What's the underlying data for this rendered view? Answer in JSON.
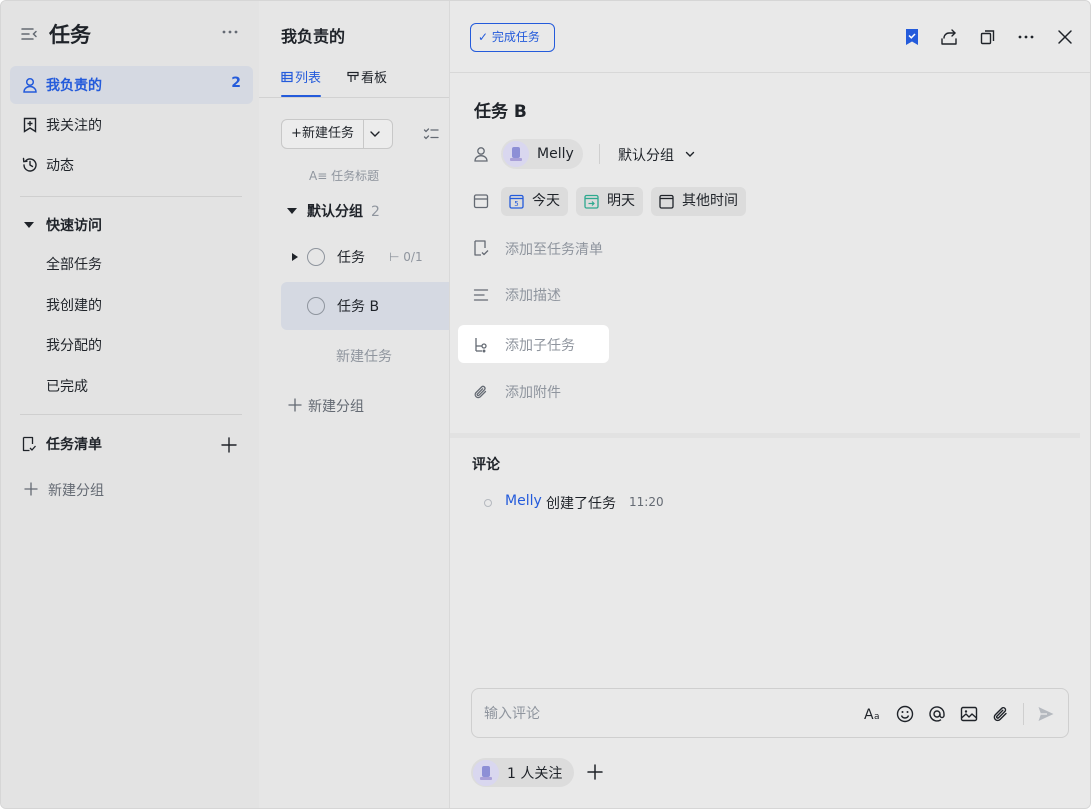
{
  "sidebar": {
    "title": "任务",
    "nav": [
      {
        "label": "我负责的",
        "count": "2"
      },
      {
        "label": "我关注的"
      },
      {
        "label": "动态"
      }
    ],
    "quick_access": {
      "label": "快速访问",
      "items": [
        "全部任务",
        "我创建的",
        "我分配的",
        "已完成"
      ]
    },
    "task_lists": {
      "label": "任务清单"
    },
    "new_group_label": "新建分组"
  },
  "list_panel": {
    "title": "我负责的",
    "tabs": [
      {
        "label": "列表",
        "active": true
      },
      {
        "label": "看板",
        "active": false
      }
    ],
    "new_task_button": "新建任务",
    "column_header": "任务标题",
    "group": {
      "name": "默认分组",
      "count": "2"
    },
    "tasks": [
      {
        "name": "任务",
        "subtasks": "0/1"
      },
      {
        "name": "任务 B",
        "selected": true
      }
    ],
    "new_task_placeholder": "新建任务",
    "new_group_label": "新建分组"
  },
  "detail": {
    "complete_button": "完成任务",
    "title": "任务 B",
    "assignee": "Melly",
    "group": "默认分组",
    "due_options": [
      {
        "label": "今天",
        "icon": "calendar-today-icon"
      },
      {
        "label": "明天",
        "icon": "calendar-tomorrow-icon"
      },
      {
        "label": "其他时间",
        "icon": "calendar-icon"
      }
    ],
    "add_to_list": "添加至任务清单",
    "add_description": "添加描述",
    "add_subtask": "添加子任务",
    "add_attachment": "添加附件",
    "comments_title": "评论",
    "activity": {
      "actor": "Melly",
      "action": "创建了任务",
      "time": "11:20"
    },
    "comment_placeholder": "输入评论",
    "followers_label": "1 人关注"
  },
  "colors": {
    "accent": "#245bdb",
    "selected_bg": "#d5d9e2",
    "muted_text": "#8f959e"
  }
}
